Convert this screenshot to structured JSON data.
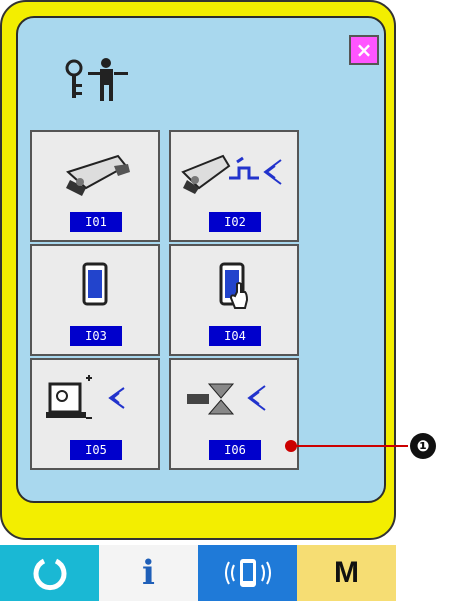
{
  "header": {
    "icon": "maintenance-person-key-icon"
  },
  "close_button": {
    "label": "×",
    "icon": "close-icon",
    "color": "#ff55ff"
  },
  "tiles": [
    {
      "code": "I01",
      "icon": "presser-foot-icon"
    },
    {
      "code": "I02",
      "icon": "presser-foot-signal-icon"
    },
    {
      "code": "I03",
      "icon": "sensor-display-icon"
    },
    {
      "code": "I04",
      "icon": "touch-panel-icon"
    },
    {
      "code": "I05",
      "icon": "output-check-icon"
    },
    {
      "code": "I06",
      "icon": "solenoid-output-icon"
    }
  ],
  "callout": {
    "number": "❶"
  },
  "bottom_bar": {
    "ready_icon": "ready-ring-icon",
    "info_label": "i",
    "comm_icon": "communication-icon",
    "mode_label": "M"
  }
}
